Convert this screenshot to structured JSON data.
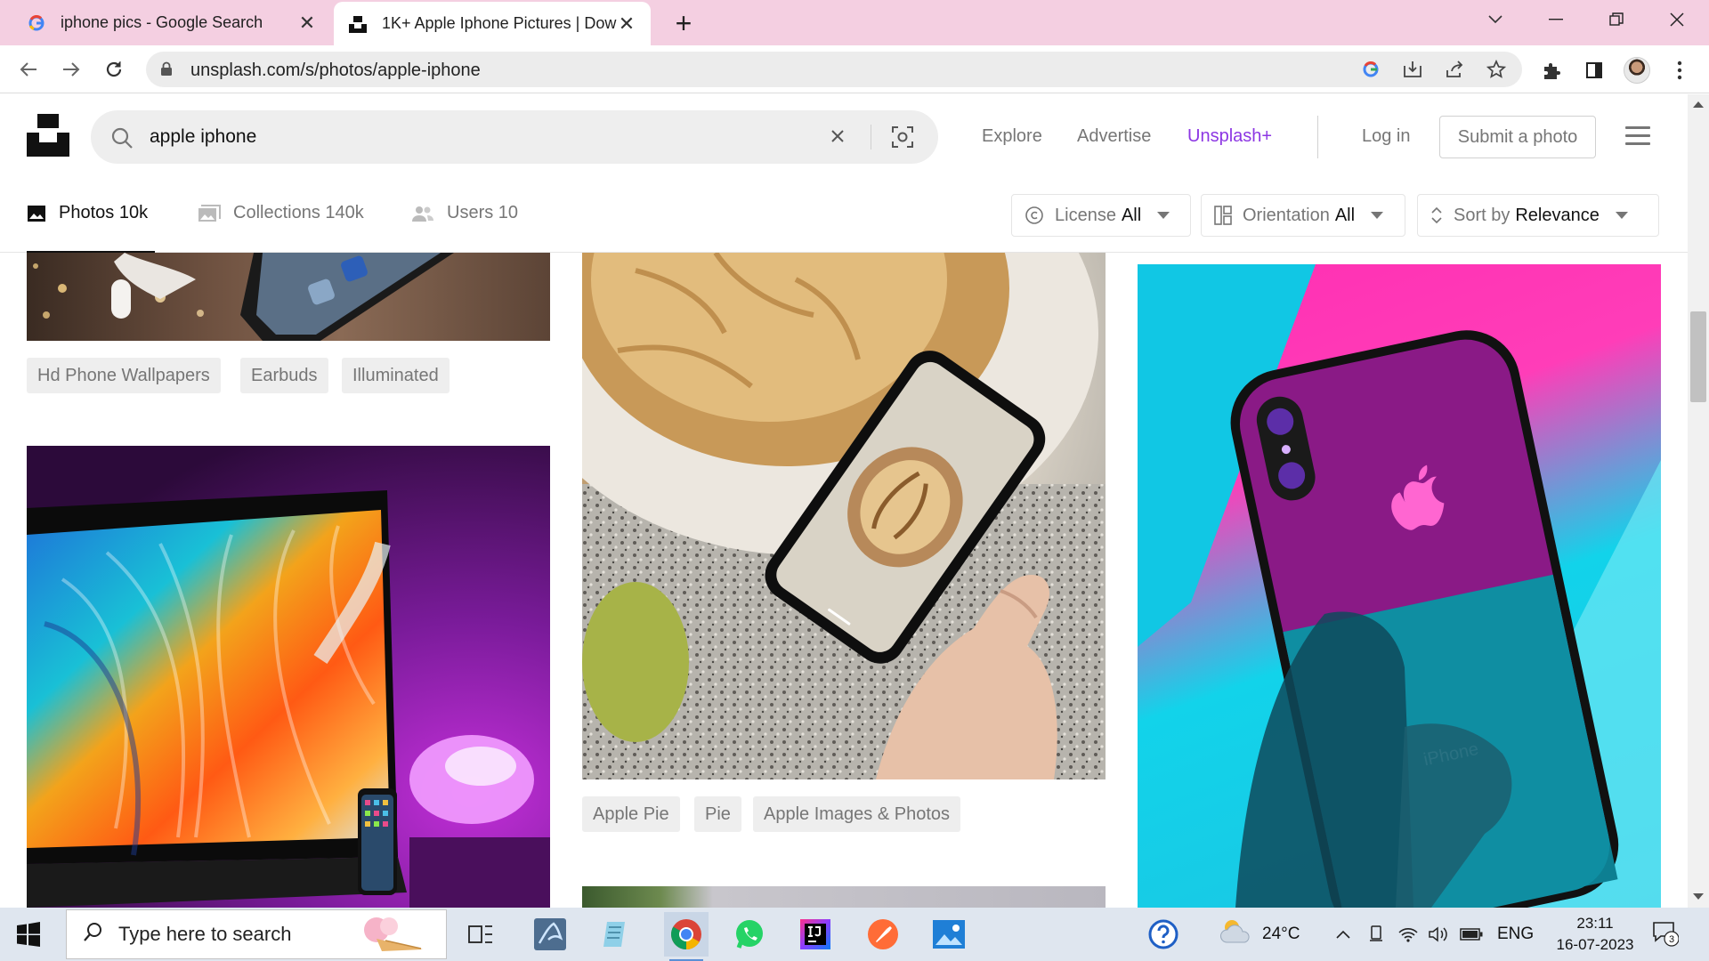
{
  "browser": {
    "tabs": [
      {
        "title": "iphone pics - Google Search",
        "icon": "google-g-icon",
        "active": false
      },
      {
        "title": "1K+ Apple Iphone Pictures | Dow",
        "icon": "unsplash-icon",
        "active": true
      }
    ],
    "url": "unsplash.com/s/photos/apple-iphone"
  },
  "header": {
    "search_query": "apple iphone",
    "nav": {
      "explore": "Explore",
      "advertise": "Advertise",
      "plus": "Unsplash+"
    },
    "login": "Log in",
    "submit": "Submit a photo"
  },
  "filters": {
    "tabs": [
      {
        "label": "Photos",
        "count": "10k"
      },
      {
        "label": "Collections",
        "count": "140k"
      },
      {
        "label": "Users",
        "count": "10"
      }
    ],
    "license": {
      "label": "License",
      "value": "All"
    },
    "orientation": {
      "label": "Orientation",
      "value": "All"
    },
    "sort": {
      "label": "Sort by",
      "value": "Relevance"
    }
  },
  "gallery": {
    "col1_tags": [
      "Hd Phone Wallpapers",
      "Earbuds",
      "Illuminated"
    ],
    "col2_tags": [
      "Apple Pie",
      "Pie",
      "Apple Images & Photos"
    ],
    "phone_text": "iPhone"
  },
  "taskbar": {
    "search_placeholder": "Type here to search",
    "weather": "24°C",
    "language": "ENG",
    "time": "23:11",
    "date": "16-07-2023",
    "notification_count": "3"
  },
  "colors": {
    "accent_plus": "#8c36e3",
    "tab_strip": "#f4cfe1"
  }
}
